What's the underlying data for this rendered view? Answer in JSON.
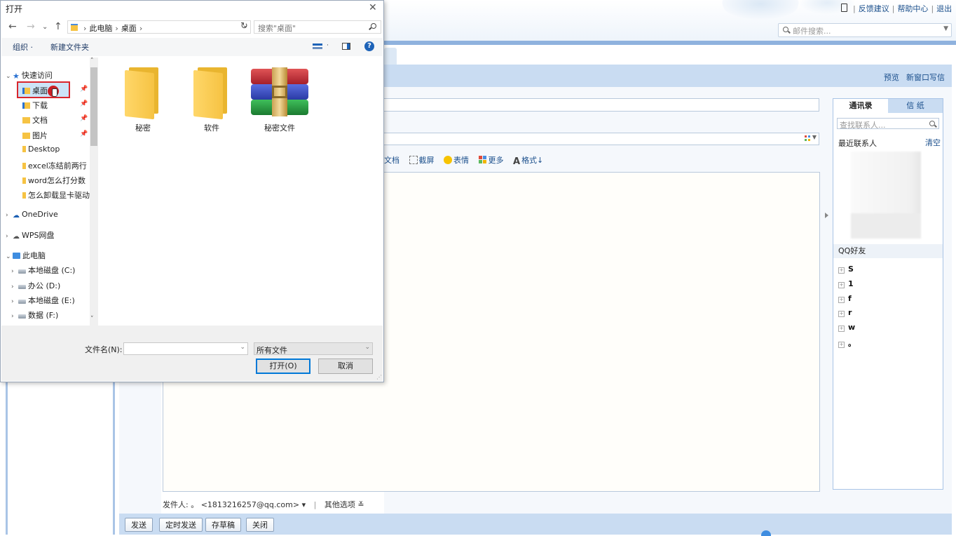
{
  "mail": {
    "top_links": [
      "反馈建议",
      "帮助中心",
      "退出"
    ],
    "search_placeholder": "邮件搜索...",
    "subbar_links": [
      "预览",
      "新窗口写信"
    ],
    "toolbar": [
      {
        "icon": "doc-icon",
        "label": "文档"
      },
      {
        "icon": "screenshot-icon",
        "label": "截屏"
      },
      {
        "icon": "emoji-icon",
        "label": "表情"
      },
      {
        "icon": "more-icon",
        "label": "更多"
      },
      {
        "icon": "font-icon",
        "label": "格式↓"
      }
    ],
    "sender_label": "发件人:",
    "sender_name": "。",
    "sender_email": "<1813216257@qq.com>",
    "other_options": "其他选项",
    "buttons": {
      "send": "发送",
      "scheduled": "定时发送",
      "draft": "存草稿",
      "close": "关闭"
    },
    "right_panel": {
      "tab_contacts": "通讯录",
      "tab_stationery": "信 纸",
      "contact_search_placeholder": "查找联系人...",
      "recent_label": "最近联系人",
      "clear": "清空",
      "qq_friends": "QQ好友",
      "groups": [
        "S",
        "1",
        "f",
        "r",
        "w",
        "。"
      ]
    }
  },
  "dialog": {
    "title": "打开",
    "address": {
      "root": "此电脑",
      "current": "桌面"
    },
    "search_placeholder": "搜索\"桌面\"",
    "organize": "组织 ·",
    "new_folder": "新建文件夹",
    "help": "?",
    "nav": {
      "quick_access": "快速访问",
      "desktop": "桌面",
      "downloads": "下载",
      "documents": "文档",
      "pictures": "图片",
      "desktop_en": "Desktop",
      "folder1": "excel冻结前两行",
      "folder2": "word怎么打分数",
      "folder3": "怎么卸载显卡驱动",
      "onedrive": "OneDrive",
      "wps": "WPS网盘",
      "this_pc": "此电脑",
      "drive_c": "本地磁盘 (C:)",
      "drive_d": "办公 (D:)",
      "drive_e": "本地磁盘 (E:)",
      "drive_f": "数据 (F:)"
    },
    "files": [
      {
        "name": "秘密",
        "type": "folder"
      },
      {
        "name": "软件",
        "type": "folder"
      },
      {
        "name": "秘密文件",
        "type": "rar-archive"
      }
    ],
    "filename_label": "文件名(N):",
    "filename_value": "",
    "filetype": "所有文件",
    "open_button": "打开(O)",
    "cancel_button": "取消"
  },
  "colors": {
    "accent": "#0078d7",
    "highlight_border": "#d9262c",
    "mail_band": "#c9dcf2",
    "link": "#1b4f8c"
  }
}
